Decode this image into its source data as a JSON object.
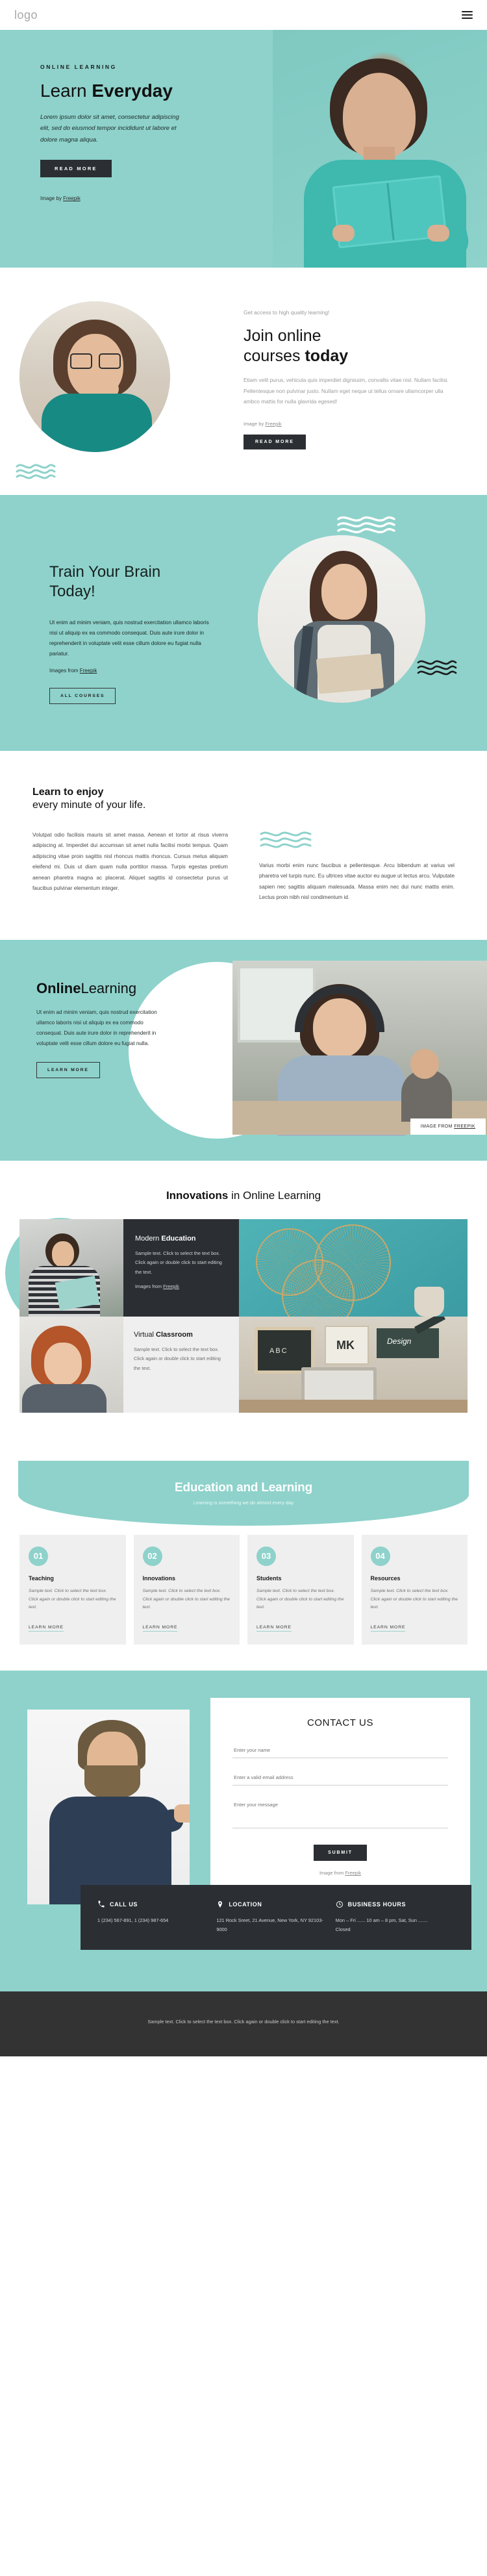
{
  "header": {
    "logo": "logo",
    "menu_icon": "hamburger-icon"
  },
  "hero": {
    "eyebrow": "ONLINE LEARNING",
    "title_light": "Learn ",
    "title_bold": "Everyday",
    "description": "Lorem ipsum dolor sit amet, consectetur adipiscing elit, sed do eiusmod tempor incididunt ut labore et dolore magna aliqua.",
    "button": "READ MORE",
    "credit_prefix": "Image by ",
    "credit_link": "Freepik"
  },
  "join": {
    "kicker": "Get access to high quality learning!",
    "title_line1": "Join online",
    "title_line2_light": "courses ",
    "title_line2_bold": "today",
    "description": "Etiam velit purus, vehicula quis imperdiet dignissim, convallis vitae nisl. Nullam facilisi. Pellentesque non pulvinar justo. Nullam eget neque ut tellus ornare ullamcorper ulla ambco mattis for nulla glavrida egesed!",
    "credit_prefix": "Image by ",
    "credit_link": "Freepik",
    "button": "READ MORE"
  },
  "train": {
    "title_line1": "Train Your Brain",
    "title_line2": "Today!",
    "description": "Ut enim ad minim veniam, quis nostrud exercitation ullamco laboris nisi ut aliquip ex ea commodo consequat. Duis aute irure dolor in reprehenderit in voluptate velit esse cillum dolore eu fugiat nulla pariatur.",
    "credit_prefix": "Images from ",
    "credit_link": "Freepik",
    "button": "ALL COURSES"
  },
  "enjoy": {
    "heading_bold": "Learn to enjoy",
    "heading_light": "every minute of your life.",
    "left_paragraph": "Volutpat odio facilisis mauris sit amet massa. Aenean et tortor at risus viverra adipiscing at. Imperdiet dui accumsan sit amet nulla facilisi morbi tempus. Quam adipiscing vitae proin sagittis nisl rhoncus mattis rhoncus. Cursus metus aliquam eleifend mi. Duis ut diam quam nulla porttitor massa. Turpis egestas pretium aenean pharetra magna ac placerat. Aliquet sagittis id consectetur purus ut faucibus pulvinar elementum integer.",
    "right_paragraph": "Varius morbi enim nunc faucibus a pellentesque. Arcu bibendum at varius vel pharetra vel turpis nunc. Eu ultrices vitae auctor eu augue ut lectus arcu. Vulputate sapien nec sagittis aliquam malesuada. Massa enim nec dui nunc mattis enim. Lectus proin nibh nisl condimentum id."
  },
  "online_learning": {
    "title_bold": "Online",
    "title_light": "Learning",
    "description": "Ut enim ad minim veniam, quis nostrud exercitation ullamco laboris nisi ut aliquip ex ea commodo consequat. Duis aute irure dolor in reprehenderit in voluptate velit esse cillum dolore eu fugiat nulla.",
    "button": "LEARN MORE",
    "image_credit_prefix": "IMAGE FROM ",
    "image_credit_link": "FREEPIK"
  },
  "innovations": {
    "title_bold": "Innovations",
    "title_light": " in Online Learning",
    "cards": [
      {
        "title_light": "Modern ",
        "title_bold": "Education",
        "text": "Sample text. Click to select the text box. Click again or double click to start editing the text.",
        "credit_prefix": "Images from ",
        "credit_link": "Freepik"
      },
      {
        "title_light": "Virtual ",
        "title_bold": "Classroom",
        "text": "Sample text. Click to select the text box. Click again or double click to start editing the text."
      }
    ]
  },
  "education": {
    "banner_title": "Education and Learning",
    "banner_subtitle": "Learning is something we do almost every day",
    "cards": [
      {
        "number": "01",
        "title": "Teaching",
        "text": "Sample text. Click to select the text box. Click again or double click to start editing the text.",
        "link": "LEARN MORE"
      },
      {
        "number": "02",
        "title": "Innovations",
        "text": "Sample text. Click to select the text box. Click again or double click to start editing the text.",
        "link": "LEARN MORE"
      },
      {
        "number": "03",
        "title": "Students",
        "text": "Sample text. Click to select the text box. Click again or double click to start editing the text.",
        "link": "LEARN MORE"
      },
      {
        "number": "04",
        "title": "Resources",
        "text": "Sample text. Click to select the text box. Click again or double click to start editing the text.",
        "link": "LEARN MORE"
      }
    ]
  },
  "contact": {
    "title": "CONTACT US",
    "name_placeholder": "Enter your name",
    "email_placeholder": "Enter a valid email address",
    "message_placeholder": "Enter your message",
    "submit": "SUBMIT",
    "credit_prefix": "Image from ",
    "credit_link": "Freepik",
    "info": [
      {
        "icon": "phone-icon",
        "label": "CALL US",
        "value": "1 (234) 567-891, 1 (234) 987-654"
      },
      {
        "icon": "location-pin-icon",
        "label": "LOCATION",
        "value": "121 Rock Sreet, 21 Avenue, New York, NY 92103-9000"
      },
      {
        "icon": "clock-icon",
        "label": "BUSINESS HOURS",
        "value": "Mon – Fri ...... 10 am – 8 pm, Sat, Sun ....... Closed"
      }
    ]
  },
  "footer": {
    "text": "Sample text. Click to select the text box. Click again or double click to start editing the text."
  },
  "colors": {
    "teal": "#8ed2cb",
    "dark": "#2b2f33",
    "footer": "#333333",
    "card_gray": "#efefef"
  }
}
